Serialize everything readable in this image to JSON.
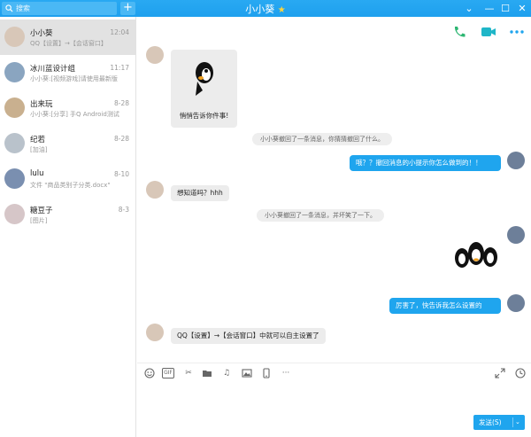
{
  "titlebar": {
    "search_placeholder": "搜索",
    "add_symbol": "+",
    "title": "小小葵",
    "star": "★",
    "controls": [
      "⌄",
      "—",
      "☐",
      "✕"
    ]
  },
  "conversations": [
    {
      "name": "小小葵",
      "time": "12:04",
      "preview": "QQ【设置】→【会话窗口】",
      "avatar_color": "#d8c7b8"
    },
    {
      "name": "冰川蓝设计组",
      "time": "11:17",
      "preview": "小小葵:[视频游戏]请使用最新版",
      "avatar_color": "#8aa5c0"
    },
    {
      "name": "出来玩",
      "time": "8-28",
      "preview": "小小葵:[分享] 手Q Android测试",
      "avatar_color": "#c9b08f"
    },
    {
      "name": "纪若",
      "time": "8-28",
      "preview": "[加油]",
      "avatar_color": "#b9c2cb"
    },
    {
      "name": "lulu",
      "time": "8-10",
      "preview": "文件 \"商品类别子分类.docx\"",
      "avatar_color": "#7a8fb0"
    },
    {
      "name": "糖豆子",
      "time": "8-3",
      "preview": "[图片]",
      "avatar_color": "#d6c6c8"
    }
  ],
  "chat": {
    "sticker_caption": "悄悄告诉你件事!",
    "sys1": "小小葵撤回了一条消息，你猜猜撤回了什么。",
    "right1": "哦？？撤回消息的小提示你怎么做到的！！",
    "left1": "想知道吗？hhh",
    "sys2": "小小葵撤回了一条消息，并坏笑了一下。",
    "right2": "厉害了，快告诉我怎么设置的",
    "left2": "QQ【设置】→【会话窗口】中就可以自主设置了"
  },
  "toolbar": {
    "icons": [
      "emoji-icon",
      "gif-icon",
      "scissors-icon",
      "folder-icon",
      "music-icon",
      "image-icon",
      "phone-screen-icon",
      "more-icon"
    ],
    "gif_label": "GIF",
    "more_label": "···"
  },
  "send": {
    "label": "发送(S)",
    "dropdown": "⌄"
  },
  "colors": {
    "accent": "#1fa5ee",
    "call_green": "#2db672",
    "video_teal": "#1fb6c8",
    "bubble_grey": "#ececec"
  }
}
